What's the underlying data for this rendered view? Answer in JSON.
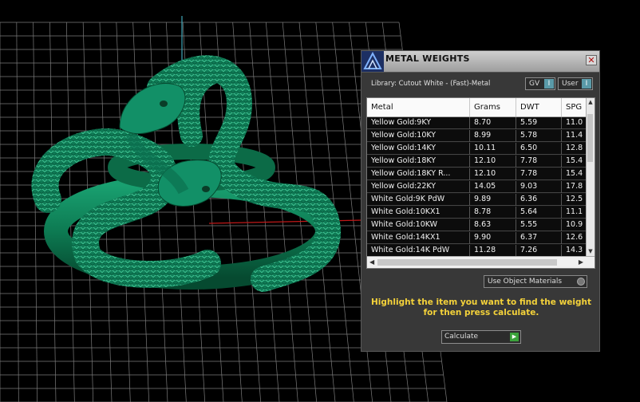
{
  "dialog": {
    "title": "METAL WEIGHTS",
    "close_icon": "close-icon",
    "library_label": "Library: Cutout White - (Fast)-Metal",
    "toggles": [
      {
        "label": "GV",
        "indicator": "I"
      },
      {
        "label": "User",
        "indicator": "I"
      }
    ],
    "table": {
      "columns": [
        "Metal",
        "Grams",
        "DWT",
        "SPG"
      ],
      "rows": [
        [
          "Yellow Gold:9KY",
          "8.70",
          "5.59",
          "11.0"
        ],
        [
          "Yellow Gold:10KY",
          "8.99",
          "5.78",
          "11.4"
        ],
        [
          "Yellow Gold:14KY",
          "10.11",
          "6.50",
          "12.8"
        ],
        [
          "Yellow Gold:18KY",
          "12.10",
          "7.78",
          "15.4"
        ],
        [
          "Yellow Gold:18KY R...",
          "12.10",
          "7.78",
          "15.4"
        ],
        [
          "Yellow Gold:22KY",
          "14.05",
          "9.03",
          "17.8"
        ],
        [
          "White Gold:9K PdW",
          "9.89",
          "6.36",
          "12.5"
        ],
        [
          "White Gold:10KX1",
          "8.78",
          "5.64",
          "11.1"
        ],
        [
          "White Gold:10KW",
          "8.63",
          "5.55",
          "10.9"
        ],
        [
          "White Gold:14KX1",
          "9.90",
          "6.37",
          "12.6"
        ],
        [
          "White Gold:14K PdW",
          "11.28",
          "7.26",
          "14.3"
        ]
      ]
    },
    "use_materials_label": "Use Object Materials",
    "instruction": "Highlight the item you want to find the weight for then press calculate.",
    "calculate_label": "Calculate"
  },
  "colors": {
    "background": "#000000",
    "grid": "#8a8a8a",
    "ring": "#11855c",
    "instruction_text": "#f4d23a",
    "axis_red": "#c01818",
    "axis_cyan": "#3fa7b8"
  }
}
